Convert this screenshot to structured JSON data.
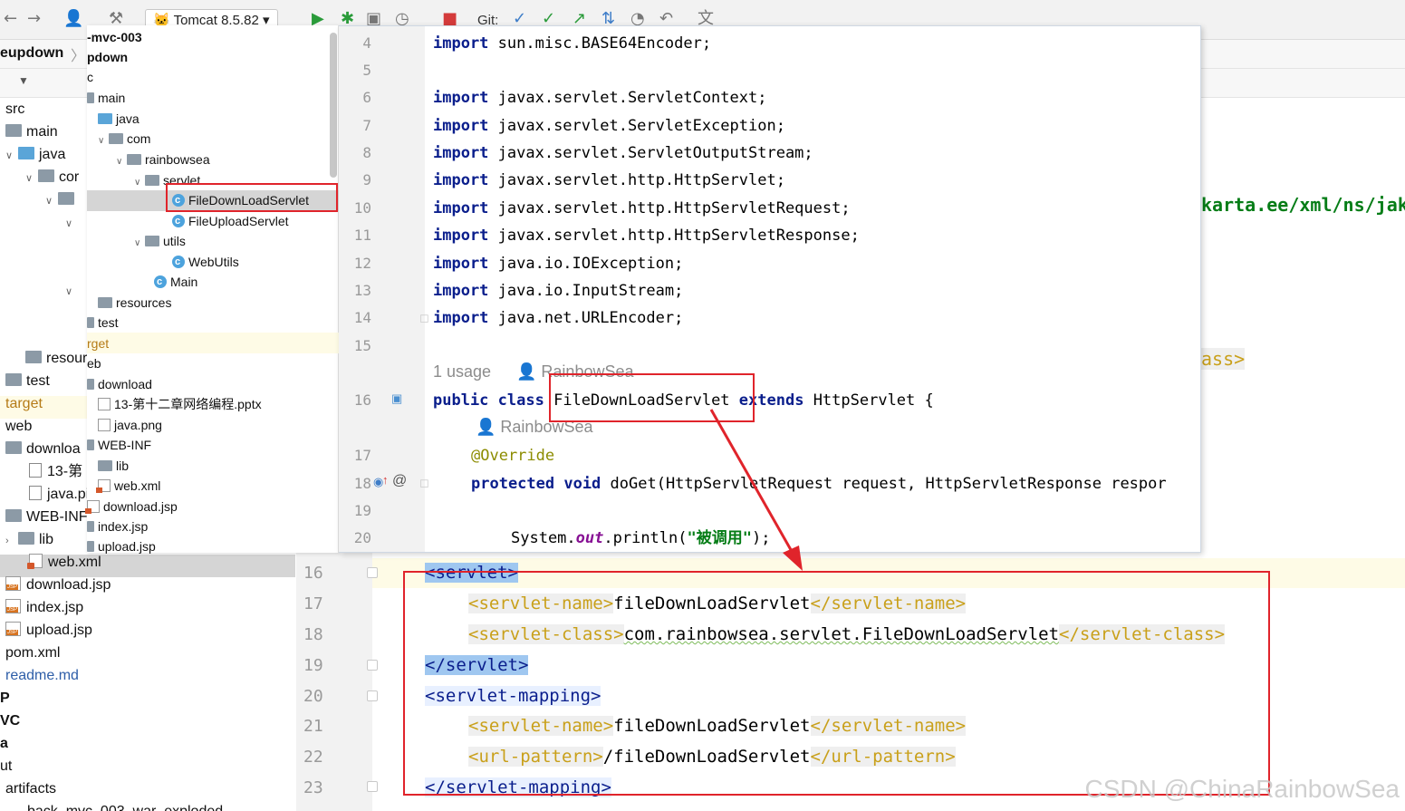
{
  "toolbar": {
    "run_config": "Tomcat 8.5.82",
    "git_label": "Git:"
  },
  "breadcrumb": {
    "project": "eupdown"
  },
  "back_tree": {
    "items": [
      {
        "label": "src"
      },
      {
        "label": "main"
      },
      {
        "label": "java"
      },
      {
        "label": "cor"
      },
      {
        "label": "resour"
      },
      {
        "label": "test"
      },
      {
        "label": "target"
      },
      {
        "label": "web"
      },
      {
        "label": "downloa"
      },
      {
        "label": "13-第"
      },
      {
        "label": "java.pi"
      },
      {
        "label": "WEB-INF"
      },
      {
        "label": "lib"
      },
      {
        "label": "web.xml"
      },
      {
        "label": "download.jsp"
      },
      {
        "label": "index.jsp"
      },
      {
        "label": "upload.jsp"
      },
      {
        "label": "pom.xml"
      },
      {
        "label": "readme.md"
      },
      {
        "label": "P"
      },
      {
        "label": "VC"
      },
      {
        "label": "a"
      },
      {
        "label": "ut"
      },
      {
        "label": "artifacts"
      },
      {
        "label": "back_mvc_003_war_exploded"
      }
    ]
  },
  "popup_tree": {
    "items": [
      {
        "label": "-mvc-003"
      },
      {
        "label": "pdown"
      },
      {
        "label": "c"
      },
      {
        "label": "main"
      },
      {
        "label": "java"
      },
      {
        "label": "com"
      },
      {
        "label": "rainbowsea"
      },
      {
        "label": "servlet"
      },
      {
        "label": "FileDownLoadServlet"
      },
      {
        "label": "FileUploadServlet"
      },
      {
        "label": "utils"
      },
      {
        "label": "WebUtils"
      },
      {
        "label": "Main"
      },
      {
        "label": "resources"
      },
      {
        "label": "test"
      },
      {
        "label": "rget"
      },
      {
        "label": "eb"
      },
      {
        "label": "download"
      },
      {
        "label": "13-第十二章网络编程.pptx"
      },
      {
        "label": "java.png"
      },
      {
        "label": "WEB-INF"
      },
      {
        "label": "lib"
      },
      {
        "label": "web.xml"
      },
      {
        "label": "download.jsp"
      },
      {
        "label": "index.jsp"
      },
      {
        "label": "upload.jsp"
      }
    ]
  },
  "java_editor": {
    "line_numbers": [
      "4",
      "5",
      "6",
      "7",
      "8",
      "9",
      "10",
      "11",
      "12",
      "13",
      "14",
      "15",
      "16",
      "17",
      "18",
      "19",
      "20"
    ],
    "imports": [
      {
        "kw": "import",
        "rest": " sun.misc.BASE64Encoder;"
      },
      {
        "kw": "import",
        "rest": " javax.servlet.ServletContext;"
      },
      {
        "kw": "import",
        "rest": " javax.servlet.ServletException;"
      },
      {
        "kw": "import",
        "rest": " javax.servlet.ServletOutputStream;"
      },
      {
        "kw": "import",
        "rest": " javax.servlet.http.HttpServlet;"
      },
      {
        "kw": "import",
        "rest": " javax.servlet.http.HttpServletRequest;"
      },
      {
        "kw": "import",
        "rest": " javax.servlet.http.HttpServletResponse;"
      },
      {
        "kw": "import",
        "rest": " java.io.IOException;"
      },
      {
        "kw": "import",
        "rest": " java.io.InputStream;"
      },
      {
        "kw": "import",
        "rest": " java.net.URLEncoder;"
      }
    ],
    "usage_hint": "1 usage",
    "author_hint": "RainbowSea",
    "author_hint2": "RainbowSea",
    "class_kw": "public class",
    "class_name": "FileDownLoadServlet",
    "extends_kw": "extends",
    "extends_rest": " HttpServlet {",
    "override": "@Override",
    "method_kw": "protected void",
    "method_rest": " doGet(HttpServletRequest request, HttpServletResponse respor",
    "print_pre": "System.",
    "print_out": "out",
    "print_mid": ".println(",
    "print_str": "\"被调用\"",
    "print_end": ");"
  },
  "xml_editor": {
    "line_numbers": [
      "16",
      "17",
      "18",
      "19",
      "20",
      "21",
      "22",
      "23"
    ],
    "lines": [
      {
        "open": "<servlet>"
      },
      {
        "open": "<servlet-name>",
        "text": "fileDownLoadServlet",
        "close": "</servlet-name>"
      },
      {
        "open": "<servlet-class>",
        "text": "com.rainbowsea.servlet.FileDownLoadServlet",
        "close": "</servlet-class>"
      },
      {
        "open": "</servlet>"
      },
      {
        "open": "<servlet-mapping>"
      },
      {
        "open": "<servlet-name>",
        "text": "fileDownLoadServlet",
        "close": "</servlet-name>"
      },
      {
        "open": "<url-pattern>",
        "text": "/fileDownLoadServlet",
        "close": "</url-pattern>"
      },
      {
        "open": "</servlet-mapping>"
      }
    ],
    "fragment_ns": "karta.ee/xml/ns/jak",
    "fragment_ass": "ass>"
  },
  "watermark": "CSDN @ChinaRainbowSea",
  "colors": {
    "annotation_red": "#e0242b",
    "keyword_blue": "#0a1e8c",
    "xml_tag_yellow": "#c9a01a"
  }
}
